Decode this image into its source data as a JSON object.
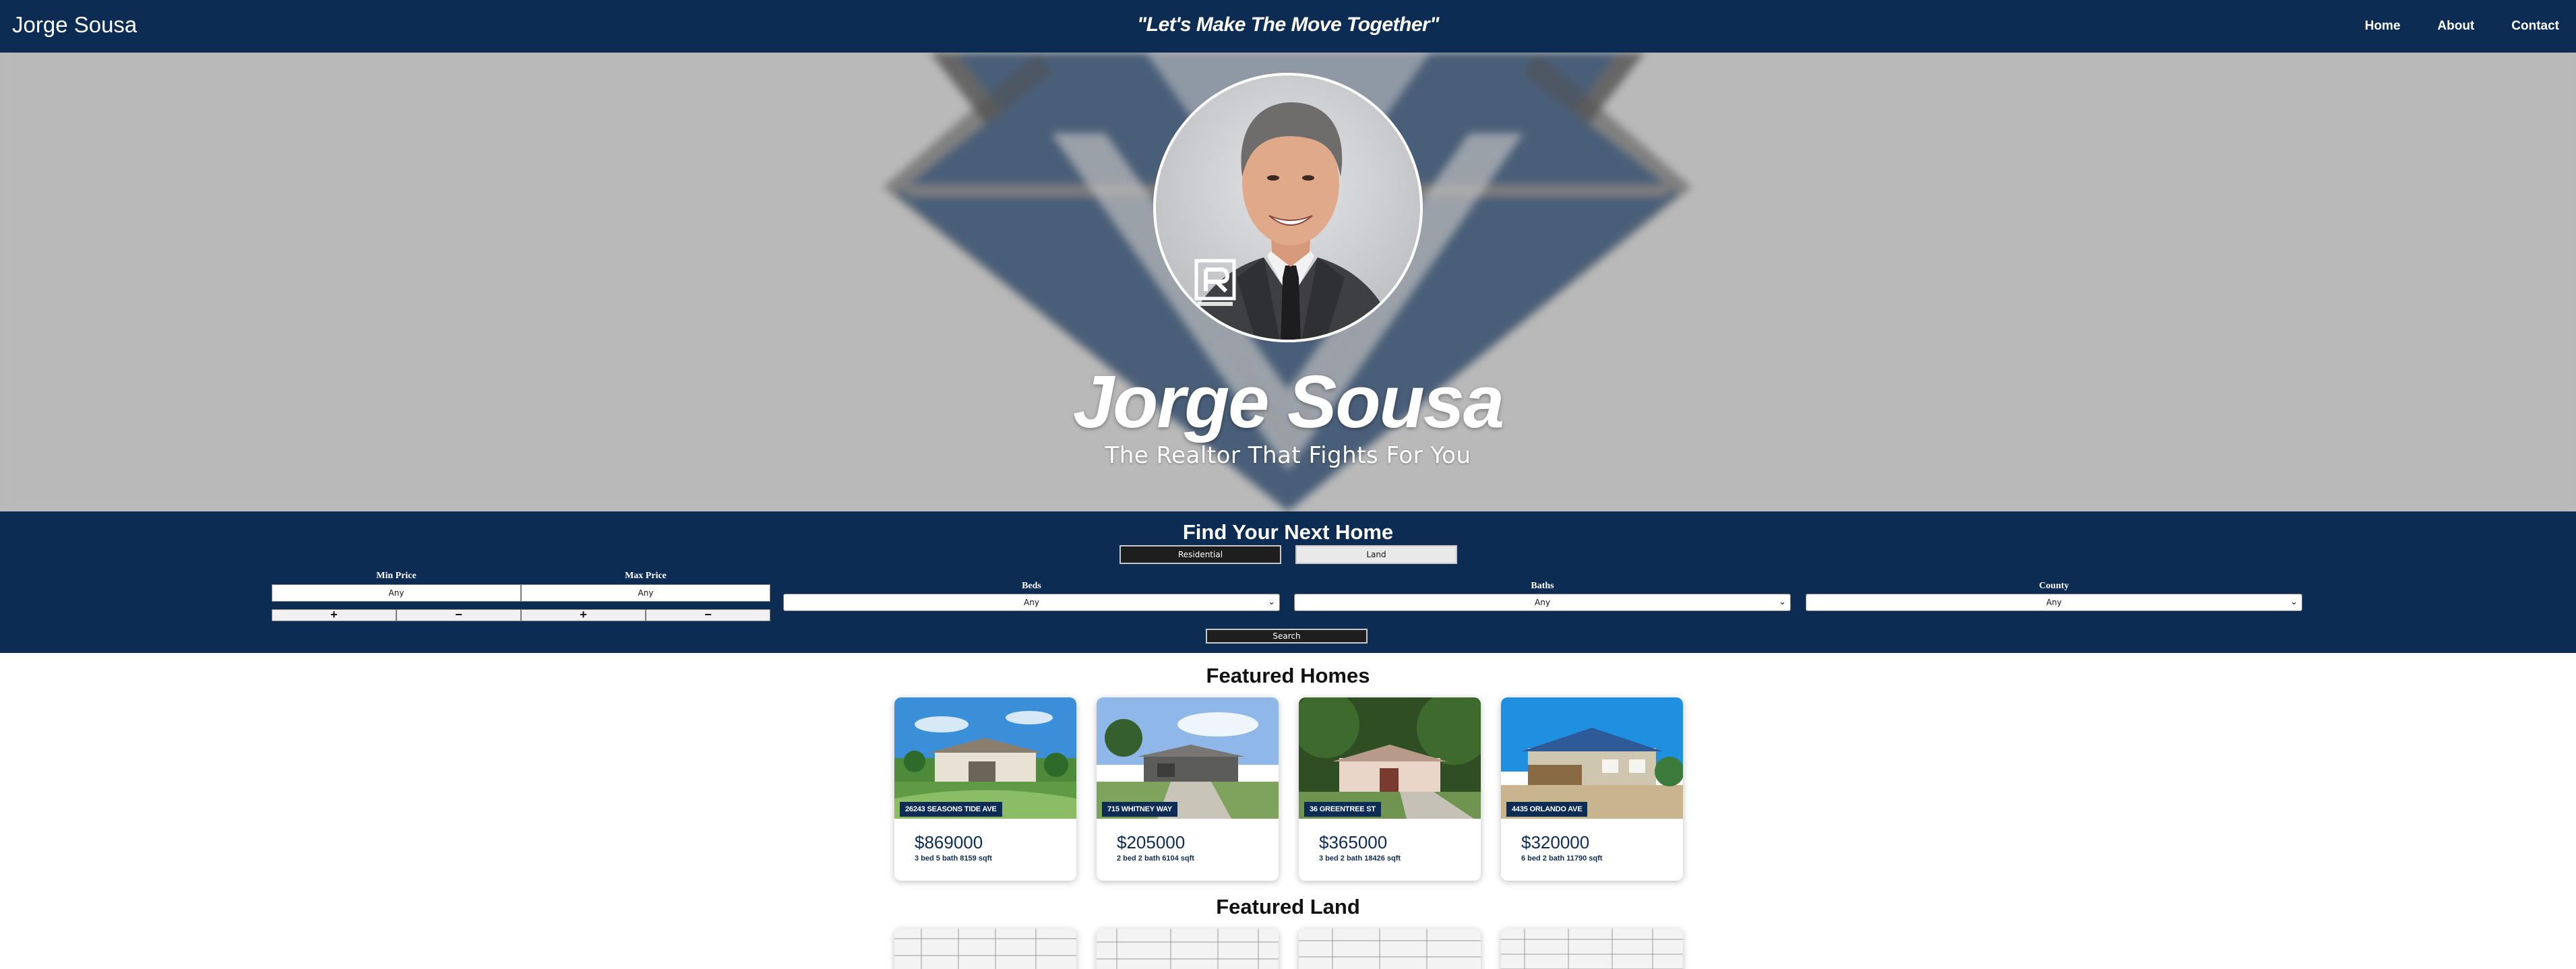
{
  "nav": {
    "brand": "Jorge Sousa",
    "tagline": "\"Let's Make The Move Together\"",
    "links": [
      "Home",
      "About",
      "Contact"
    ]
  },
  "hero": {
    "name": "Jorge Sousa",
    "subtitle": "The Realtor That Fights For You",
    "badge_icon": "realtor-r-icon"
  },
  "search": {
    "title": "Find Your Next Home",
    "property_types": [
      "Residential",
      "Land"
    ],
    "min_price": {
      "label": "Min Price",
      "value": "Any"
    },
    "max_price": {
      "label": "Max Price",
      "value": "Any"
    },
    "plus": "+",
    "minus": "−",
    "beds": {
      "label": "Beds",
      "value": "Any"
    },
    "baths": {
      "label": "Baths",
      "value": "Any"
    },
    "county": {
      "label": "County",
      "value": "Any"
    },
    "button": "Search"
  },
  "featured_homes": {
    "title": "Featured Homes",
    "items": [
      {
        "address": "26243 SEASONS TIDE AVE",
        "price": "$869000",
        "details": "3 bed 5 bath 8159 sqft"
      },
      {
        "address": "715 WHITNEY WAY",
        "price": "$205000",
        "details": "2 bed 2 bath 6104 sqft"
      },
      {
        "address": "36 GREENTREE ST",
        "price": "$365000",
        "details": "3 bed 2 bath 18426 sqft"
      },
      {
        "address": "4435 ORLANDO AVE",
        "price": "$320000",
        "details": "6 bed 2 bath 11790 sqft"
      }
    ]
  },
  "featured_land": {
    "title": "Featured Land"
  },
  "colors": {
    "navy": "#0c2c54",
    "hero_gray": "#b8b8b8"
  }
}
